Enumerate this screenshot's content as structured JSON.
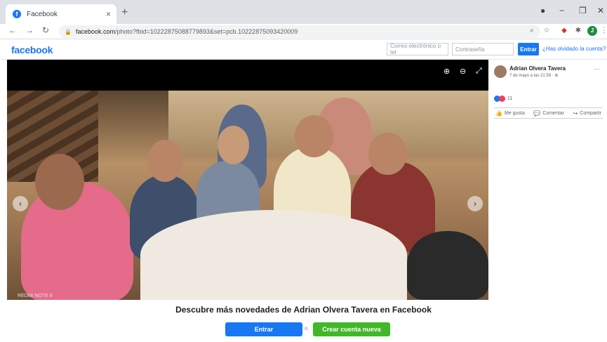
{
  "browser": {
    "tab_title": "Facebook",
    "tab_close": "×",
    "new_tab": "+",
    "url_host": "facebook.com",
    "url_path": "/photo?fbid=10222875088779893&set=pcb.10222875093420009",
    "profile_initial": "J"
  },
  "facebook": {
    "logo": "facebook",
    "email_placeholder": "Correo electrónico o tel",
    "password_placeholder": "Contraseña",
    "login_button": "Entrar",
    "forgot_link": "¿Has olvidado la cuenta?"
  },
  "photo": {
    "watermark": "REDMI NOTE 9"
  },
  "post": {
    "author": "Adrian Olvera Tavera",
    "date": "7 de mayo a las 21:59 · ",
    "more": "···",
    "reaction_count": "11",
    "actions": [
      "Me gusta",
      "Comentar",
      "Compartir"
    ]
  },
  "footer": {
    "title": "Descubre más novedades de Adrian Olvera Tavera en Facebook",
    "login_button": "Entrar",
    "separator": "o",
    "create_button": "Crear cuenta nueva"
  },
  "colors": {
    "facebook_blue": "#1877f2",
    "create_green": "#42b72a"
  }
}
